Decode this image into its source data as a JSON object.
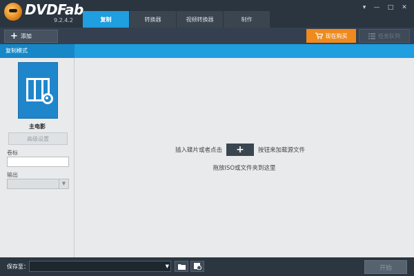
{
  "app": {
    "name": "DVDFab",
    "version": "9.2.4.2"
  },
  "tabs": [
    {
      "label": "复制",
      "active": true
    },
    {
      "label": "转换器",
      "active": false
    },
    {
      "label": "视频转换器",
      "active": false
    },
    {
      "label": "制作",
      "active": false
    }
  ],
  "window_controls": {
    "menu": "▾",
    "minimize": "—",
    "maximize": "□",
    "close": "✕"
  },
  "toolbar": {
    "add_label": "添加",
    "add_icon": "plus-icon",
    "buy_label": "现在购买",
    "buy_icon": "cart-icon",
    "queue_label": "任务队列",
    "queue_icon": "list-icon",
    "buy_color": "#f08a1c"
  },
  "strip": {
    "label": "复制模式",
    "color": "#1f9ee0"
  },
  "left_panel": {
    "mode_name": "主电影",
    "mode_icon": "film-disc-icon",
    "advanced_button": "高级设置",
    "volume_label": "卷标",
    "volume_value": "",
    "output_label": "输出",
    "output_value": ""
  },
  "main": {
    "hint_before": "插入碟片或者点击",
    "hint_after": "按钮来加载源文件",
    "hint_plus": "+",
    "hint_drag": "拖放ISO或文件夹到这里"
  },
  "bottom": {
    "save_label": "保存至：",
    "save_path": "",
    "folder_icon": "folder-icon",
    "disc_icon": "disc-icon",
    "start_label": "开始"
  }
}
